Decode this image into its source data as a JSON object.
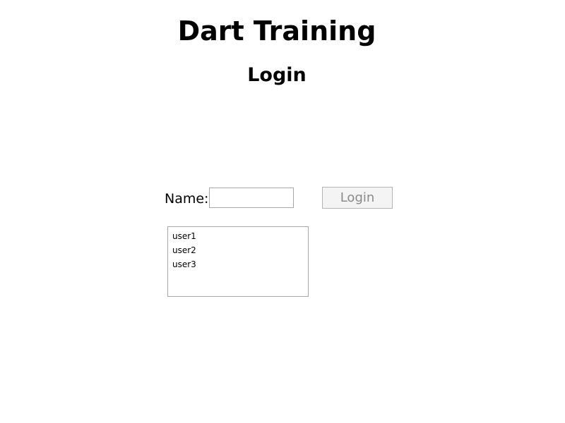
{
  "header": {
    "app_title": "Dart Training",
    "page_title": "Login"
  },
  "login_form": {
    "name_label": "Name:",
    "name_value": "",
    "name_placeholder": "",
    "login_button_label": "Login",
    "login_button_enabled": false
  },
  "user_list": {
    "items": [
      "user1",
      "user2",
      "user3"
    ]
  },
  "colors": {
    "background": "#ffffff",
    "text": "#000000",
    "disabled_text": "#8a8a8a",
    "border": "#a8a8a8",
    "button_background": "#f4f4f4"
  }
}
